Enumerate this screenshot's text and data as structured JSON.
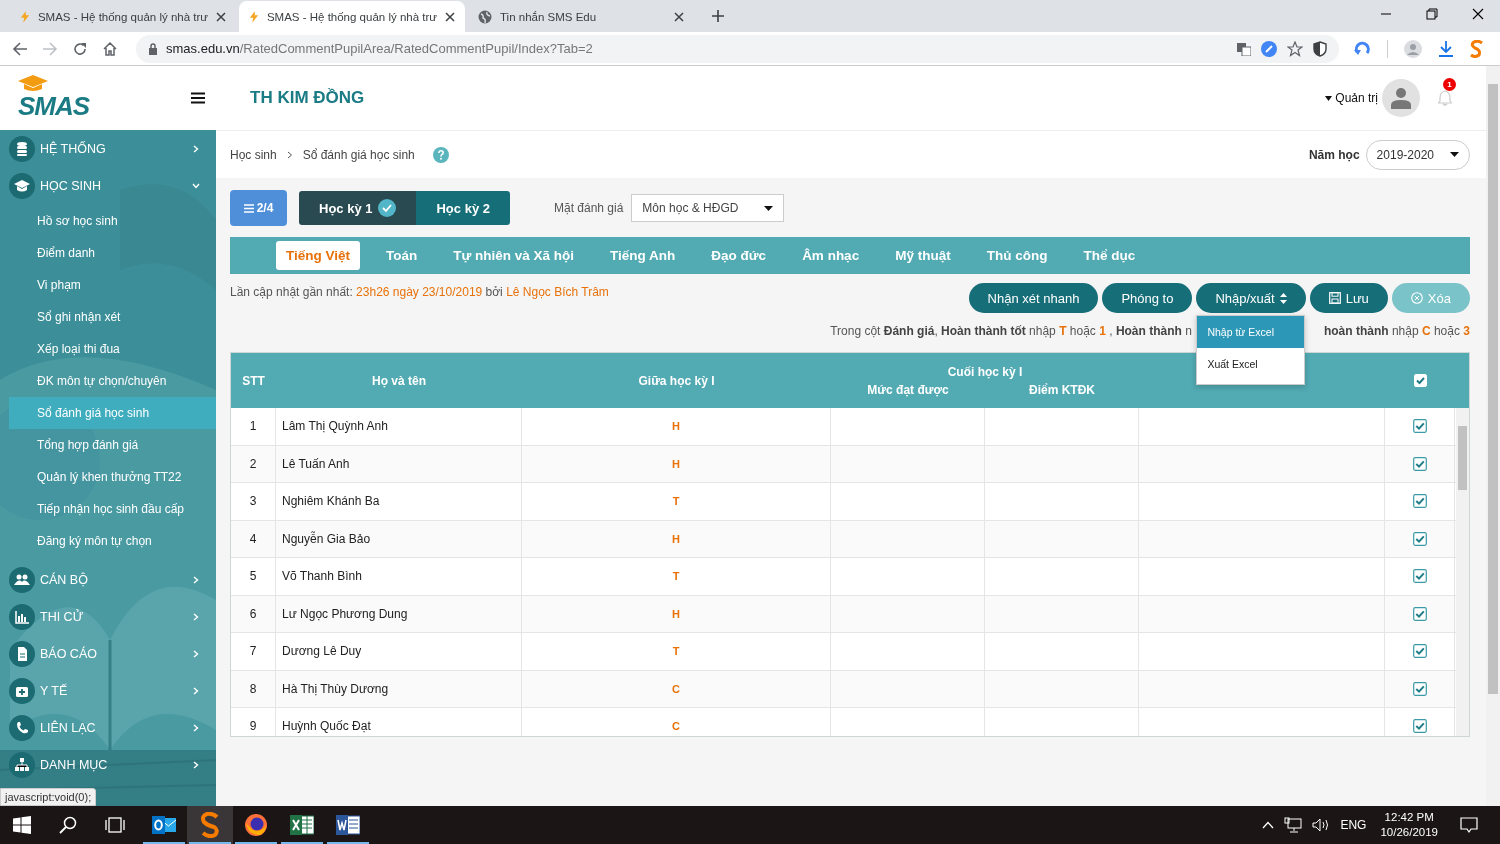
{
  "browser": {
    "tabs": [
      {
        "title": "SMAS - Hệ thống quản lý nhà trư",
        "selected": false,
        "kind": "smas"
      },
      {
        "title": "SMAS - Hệ thống quản lý nhà trư",
        "selected": true,
        "kind": "smas"
      },
      {
        "title": "Tin nhắn SMS Edu",
        "selected": false,
        "kind": "globe"
      }
    ],
    "url_host": "smas.edu.vn",
    "url_path": "/RatedCommentPupilArea/RatedCommentPupil/Index?Tab=2"
  },
  "header": {
    "logo": "SMAS",
    "school": "TH KIM ĐỒNG",
    "user": "Quản trị",
    "notifications": "1"
  },
  "sidebar": {
    "sections": [
      {
        "label": "HỆ THỐNG",
        "expanded": false
      },
      {
        "label": "HỌC SINH",
        "expanded": true,
        "children": [
          {
            "label": "Hồ sơ học sinh",
            "selected": false
          },
          {
            "label": "Điểm danh",
            "selected": false
          },
          {
            "label": "Vi phạm",
            "selected": false
          },
          {
            "label": "Sổ ghi nhận xét",
            "selected": false
          },
          {
            "label": "Xếp loại thi đua",
            "selected": false
          },
          {
            "label": "ĐK môn tự chọn/chuyên",
            "selected": false
          },
          {
            "label": "Sổ đánh giá học sinh",
            "selected": true
          },
          {
            "label": "Tổng hợp đánh giá",
            "selected": false
          },
          {
            "label": "Quản lý khen thưởng TT22",
            "selected": false
          },
          {
            "label": "Tiếp nhận học sinh đầu cấp",
            "selected": false
          },
          {
            "label": "Đăng ký môn tự chọn",
            "selected": false
          }
        ]
      },
      {
        "label": "CÁN BỘ",
        "expanded": false
      },
      {
        "label": "THI CỬ",
        "expanded": false
      },
      {
        "label": "BÁO CÁO",
        "expanded": false
      },
      {
        "label": "Y TẾ",
        "expanded": false
      },
      {
        "label": "LIÊN LẠC",
        "expanded": false
      },
      {
        "label": "DANH MỤC",
        "expanded": false
      }
    ],
    "tooltip": "javascript:void(0);"
  },
  "breadcrumb": [
    "Học sinh",
    "Sổ đánh giá học sinh"
  ],
  "school_year": {
    "label": "Năm học",
    "value": "2019-2020"
  },
  "page_button": "2/4",
  "semesters": [
    {
      "label": "Học kỳ 1",
      "selected": true
    },
    {
      "label": "Học kỳ 2",
      "selected": false
    }
  ],
  "assessment": {
    "label": "Mặt đánh giá",
    "value": "Môn học & HĐGD"
  },
  "subjects": [
    {
      "label": "Tiếng Việt",
      "selected": true
    },
    {
      "label": "Toán",
      "selected": false
    },
    {
      "label": "Tự nhiên và Xã hội",
      "selected": false
    },
    {
      "label": "Tiếng Anh",
      "selected": false
    },
    {
      "label": "Đạo đức",
      "selected": false
    },
    {
      "label": "Âm nhạc",
      "selected": false
    },
    {
      "label": "Mỹ thuật",
      "selected": false
    },
    {
      "label": "Thủ công",
      "selected": false
    },
    {
      "label": "Thể dục",
      "selected": false
    }
  ],
  "last_update": {
    "label": "Lần cập nhật gần nhất: ",
    "time": "23h26 ngày 23/10/2019",
    "by": " bởi ",
    "user": "Lê Ngọc Bích Trâm"
  },
  "actions": [
    {
      "label": "Nhận xét nhanh",
      "kind": "plain",
      "disabled": false
    },
    {
      "label": "Phóng to",
      "kind": "plain",
      "disabled": false
    },
    {
      "label": "Nhập/xuất",
      "kind": "menu",
      "disabled": false
    },
    {
      "label": "Lưu",
      "kind": "save",
      "disabled": false
    },
    {
      "label": "Xóa",
      "kind": "delete",
      "disabled": true
    }
  ],
  "menu": [
    {
      "label": "Nhập từ Excel",
      "selected": true
    },
    {
      "label": "Xuất Excel",
      "selected": false
    }
  ],
  "note_left": [
    {
      "text": "Trong cột ",
      "kind": "plain"
    },
    {
      "text": "Đánh giá",
      "kind": "bold"
    },
    {
      "text": ", ",
      "kind": "plain"
    },
    {
      "text": "Hoàn thành tốt",
      "kind": "bold"
    },
    {
      "text": " nhập ",
      "kind": "plain"
    },
    {
      "text": "T",
      "kind": "value"
    },
    {
      "text": " hoặc ",
      "kind": "plain"
    },
    {
      "text": "1",
      "kind": "value"
    },
    {
      "text": " , ",
      "kind": "plain"
    },
    {
      "text": "Hoàn thành",
      "kind": "bold"
    },
    {
      "text": " n",
      "kind": "plain"
    }
  ],
  "note_right": [
    {
      "text": "hoàn thành",
      "kind": "bold"
    },
    {
      "text": " nhập ",
      "kind": "plain"
    },
    {
      "text": "C",
      "kind": "value"
    },
    {
      "text": " hoặc ",
      "kind": "plain"
    },
    {
      "text": "3",
      "kind": "value"
    }
  ],
  "table": {
    "columns": {
      "stt": "STT",
      "name": "Họ và tên",
      "mid": "Giữa học kỳ I",
      "end": "Cuối học kỳ I",
      "level": "Mức đạt được",
      "score": "Điểm KTĐK"
    },
    "all_checked": true,
    "rows": [
      {
        "stt": "1",
        "name": "Lâm Thị Quỳnh Anh",
        "mid": "H",
        "checked": true
      },
      {
        "stt": "2",
        "name": "Lê Tuấn Anh",
        "mid": "H",
        "checked": true
      },
      {
        "stt": "3",
        "name": "Nghiêm Khánh Ba",
        "mid": "T",
        "checked": true
      },
      {
        "stt": "4",
        "name": "Nguyễn Gia Bảo",
        "mid": "H",
        "checked": true
      },
      {
        "stt": "5",
        "name": "Võ Thanh Bình",
        "mid": "T",
        "checked": true
      },
      {
        "stt": "6",
        "name": "Lư Ngọc Phương Dung",
        "mid": "H",
        "checked": true
      },
      {
        "stt": "7",
        "name": "Dương Lê Duy",
        "mid": "T",
        "checked": true
      },
      {
        "stt": "8",
        "name": "Hà Thị Thùy Dương",
        "mid": "C",
        "checked": true
      },
      {
        "stt": "9",
        "name": "Huỳnh Quốc Đạt",
        "mid": "C",
        "checked": true
      }
    ]
  },
  "taskbar": {
    "apps": [
      {
        "kind": "mail",
        "running": true,
        "selected": false
      },
      {
        "kind": "smas",
        "running": true,
        "selected": true
      },
      {
        "kind": "firefox",
        "running": true,
        "selected": false
      },
      {
        "kind": "sheet",
        "running": true,
        "selected": false
      },
      {
        "kind": "doc",
        "running": true,
        "selected": false
      }
    ],
    "language": "ENG",
    "time": "12:42 PM",
    "date": "10/26/2019"
  }
}
